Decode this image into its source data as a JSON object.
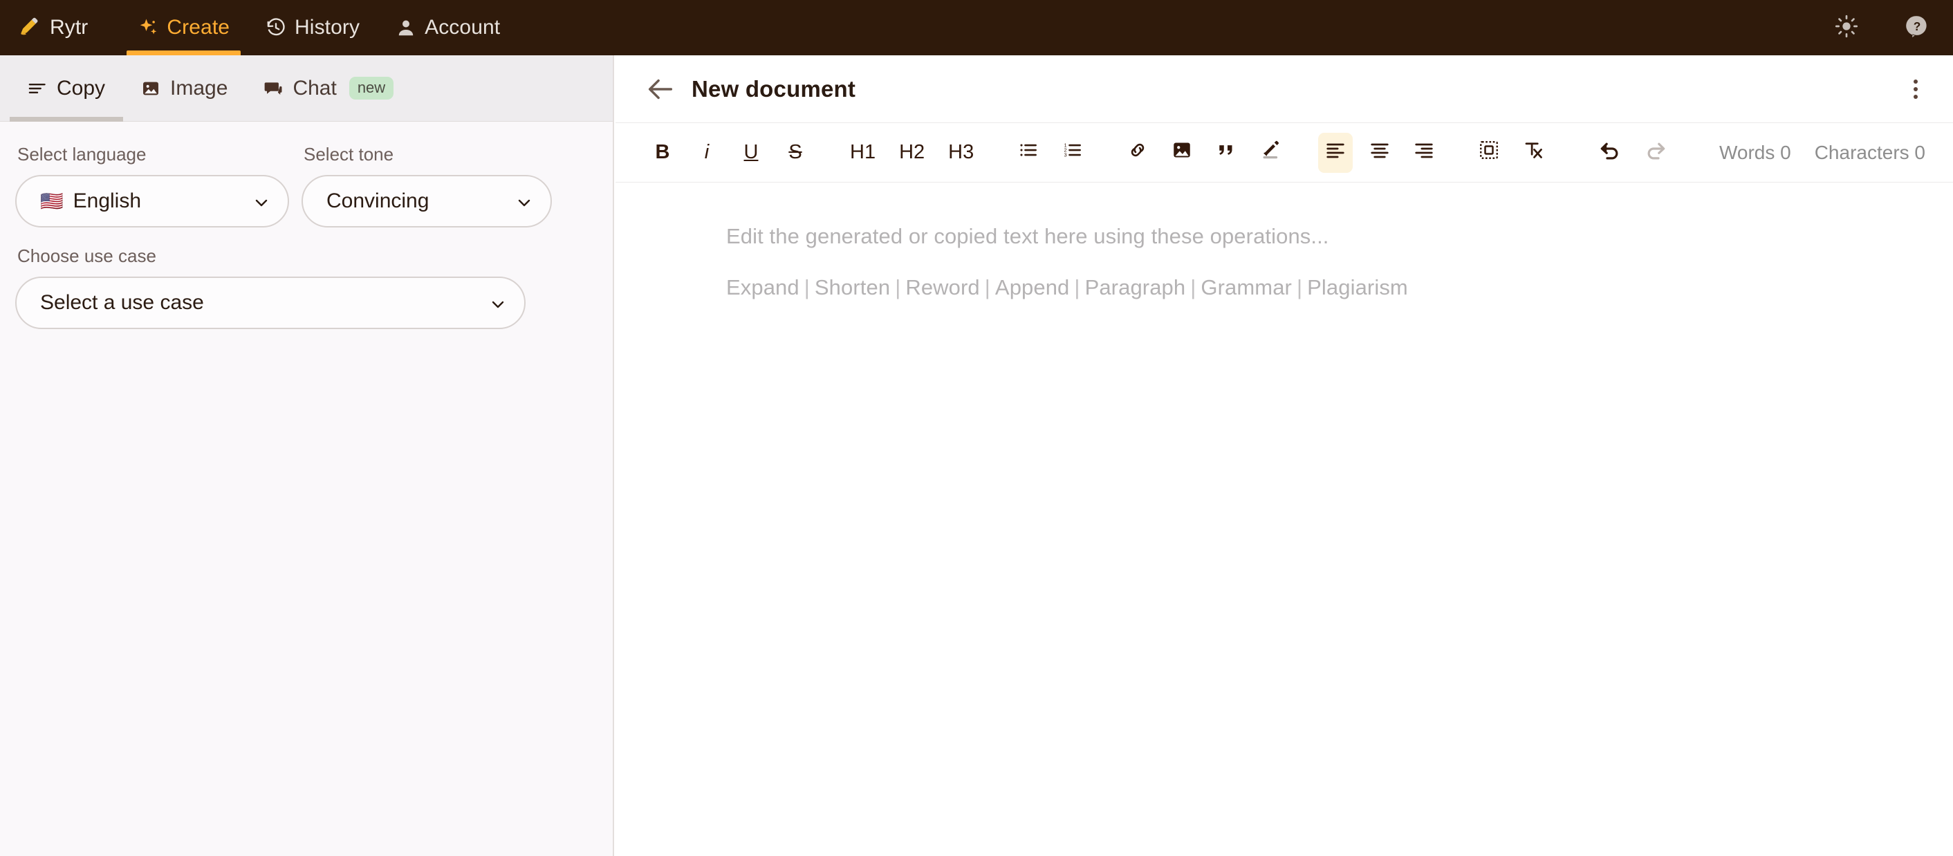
{
  "topbar": {
    "brand": {
      "label": "Rytr",
      "icon": "writing-hand-icon"
    },
    "items": [
      {
        "label": "Create",
        "icon": "sparkles-icon",
        "active": true
      },
      {
        "label": "History",
        "icon": "clock-rotate-icon",
        "active": false
      },
      {
        "label": "Account",
        "icon": "user-icon",
        "active": false
      }
    ],
    "actions": [
      {
        "name": "theme-toggle",
        "icon": "sun-icon"
      },
      {
        "name": "help",
        "icon": "help-question-icon"
      }
    ],
    "colors": {
      "background": "#2f1a0b",
      "accent": "#ffad33",
      "text": "#e8e2dd"
    }
  },
  "sidebar": {
    "tabs": [
      {
        "label": "Copy",
        "icon": "lines-icon",
        "active": true,
        "badge": ""
      },
      {
        "label": "Image",
        "icon": "image-icon",
        "active": false,
        "badge": ""
      },
      {
        "label": "Chat",
        "icon": "chat-bubble-icon",
        "active": false,
        "badge": "new"
      }
    ],
    "fields": {
      "language": {
        "label": "Select language",
        "value": "English",
        "flag": "🇺🇸"
      },
      "tone": {
        "label": "Select tone",
        "value": "Convincing"
      },
      "use_case": {
        "label": "Choose use case",
        "value": "Select a use case"
      }
    },
    "badge_color": "#c8e6c9"
  },
  "document": {
    "title": "New document",
    "back_icon": "arrow-left-icon",
    "menu_icon": "kebab-menu-icon",
    "toolbar": {
      "bold": "B",
      "italic": "i",
      "underline": "U",
      "strikethrough": "S",
      "h1": "H1",
      "h2": "H2",
      "h3": "H3",
      "bullet_list": "bullet-list-icon",
      "numbered_list": "numbered-list-icon",
      "link": "link-icon",
      "image": "image-icon",
      "quote": "quote-icon",
      "highlight": "highlighter-pen-icon",
      "align_left": "align-left-icon",
      "align_center": "align-center-icon",
      "align_right": "align-right-icon",
      "block": "dashed-block-icon",
      "clear_format": "clear-formatting-icon",
      "undo": "undo-icon",
      "redo": "redo-icon",
      "active_button": "align-left-icon",
      "disabled_button": "redo-icon",
      "active_highlight_color": "#fdf3dc"
    },
    "counts": {
      "words_label": "Words",
      "words_value": "0",
      "characters_label": "Characters",
      "characters_value": "0"
    },
    "editor": {
      "placeholder": "Edit the generated or copied text here using these operations...",
      "operations": [
        "Expand",
        "Shorten",
        "Reword",
        "Append",
        "Paragraph",
        "Grammar",
        "Plagiarism"
      ],
      "separator": "|"
    }
  }
}
